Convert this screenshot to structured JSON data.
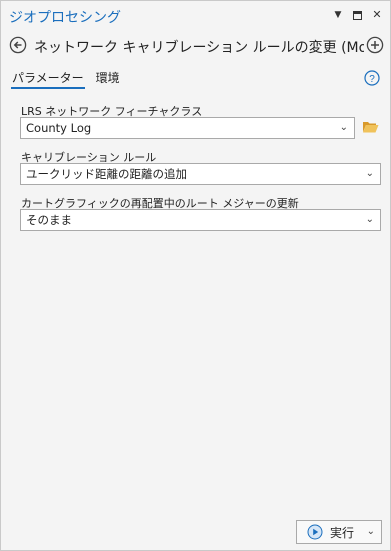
{
  "pane": {
    "title": "ジオプロセシング",
    "controls": {
      "menu_icon": "chevron-down-icon",
      "restore_icon": "restore-icon",
      "close_icon": "close-icon",
      "close_glyph": "✕",
      "menu_glyph": "▼"
    }
  },
  "tool": {
    "title": "ネットワーク キャリブレーション ルールの変更 (Modify N...",
    "back_icon": "back-arrow-icon",
    "add_icon": "add-circle-icon"
  },
  "tabs": [
    {
      "label": "パラメーター",
      "active": true
    },
    {
      "label": "環境",
      "active": false
    }
  ],
  "help_icon": "help-icon",
  "params": {
    "network": {
      "label": "LRS ネットワーク フィーチャクラス",
      "value": "County Log"
    },
    "calibration_rule": {
      "label": "キャリブレーション ルール",
      "value": "ユークリッド距離の距離の追加"
    },
    "measure_update": {
      "label": "カートグラフィックの再配置中のルート メジャーの更新",
      "value": "そのまま"
    }
  },
  "run_button": {
    "label": "実行",
    "chevron": "⌄"
  },
  "colors": {
    "accent": "#1a6ebd",
    "folder": "#e8b34a",
    "background": "#f4f4f4"
  }
}
